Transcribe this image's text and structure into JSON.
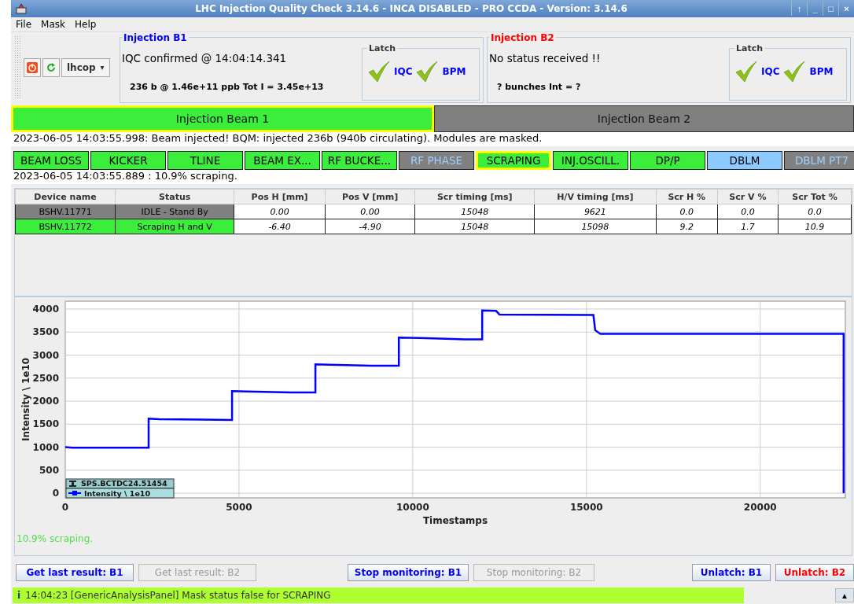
{
  "window": {
    "title": "LHC Injection Quality Check 3.14.6 -  INCA DISABLED - PRO CCDA - Version: 3.14.6",
    "controls": [
      "↑",
      "_",
      "□",
      "×"
    ]
  },
  "menu": [
    "File",
    "Mask",
    "Help"
  ],
  "toolbar": {
    "user": "lhcop",
    "caret": "▾"
  },
  "injections": [
    {
      "title": "Injection B1",
      "kind": "b1",
      "status": "IQC confirmed @ 14:04:14.341",
      "detail": "236 b @ 1.46e+11 ppb   Tot I = 3.45e+13",
      "latch": {
        "title": "Latch",
        "items": [
          {
            "label": "IQC",
            "checked": true
          },
          {
            "label": "BPM",
            "checked": true
          }
        ]
      }
    },
    {
      "title": "Injection B2",
      "kind": "b2",
      "status": "No status received !!",
      "detail": "? bunches  Int = ?",
      "latch": {
        "title": "Latch",
        "items": [
          {
            "label": "IQC",
            "checked": true
          },
          {
            "label": "BPM",
            "checked": true
          }
        ]
      }
    }
  ],
  "beam_tabs": [
    {
      "label": "Injection Beam 1",
      "selected": true
    },
    {
      "label": "Injection Beam 2",
      "selected": false
    }
  ],
  "beam_message": "2023-06-05 14:03:55.998: Beam injected! BQM: injected 236b (940b circulating). Modules are masked.",
  "modules": [
    {
      "label": "BEAM LOSS",
      "kind": "ok",
      "selected": false
    },
    {
      "label": "KICKER",
      "kind": "ok",
      "selected": false
    },
    {
      "label": "TLINE",
      "kind": "ok",
      "selected": false
    },
    {
      "label": "BEAM EX...",
      "kind": "ok",
      "selected": false
    },
    {
      "label": "RF BUCKE...",
      "kind": "ok",
      "selected": false
    },
    {
      "label": "RF PHASE",
      "kind": "masked",
      "selected": false
    },
    {
      "label": "SCRAPING",
      "kind": "ok",
      "selected": true
    },
    {
      "label": "INJ.OSCILL.",
      "kind": "ok",
      "selected": false
    },
    {
      "label": "DP/P",
      "kind": "ok",
      "selected": false
    },
    {
      "label": "DBLM",
      "kind": "info",
      "selected": false
    },
    {
      "label": "DBLM PT7",
      "kind": "masked",
      "selected": false
    }
  ],
  "module_message": "2023-06-05 14:03:55.889 : 10.9% scraping.",
  "table": {
    "columns": [
      "Device name",
      "Status",
      "Pos H [mm]",
      "Pos V [mm]",
      "Scr timing [ms]",
      "H/V timing [ms]",
      "Scr H %",
      "Scr V %",
      "Scr Tot %"
    ],
    "rows": [
      {
        "color": "#808080",
        "cells": [
          "BSHV.11771",
          "IDLE - Stand By",
          "0.00",
          "0.00",
          "15048",
          "9621",
          "0.0",
          "0.0",
          "0.0"
        ]
      },
      {
        "color": "#3cee3c",
        "cells": [
          "BSHV.11772",
          "Scraping H and V",
          "-6.40",
          "-4.90",
          "15048",
          "15098",
          "9.2",
          "1.7",
          "10.9"
        ]
      }
    ]
  },
  "chart": {
    "legend_title": "SPS.BCTDC24.51454",
    "chart_data": {
      "type": "line",
      "grid": true,
      "xlabel": "Timestamps",
      "ylabel": "Intensity \\ 1e10",
      "xlim": [
        0,
        22450
      ],
      "ylim": [
        -100,
        4170
      ],
      "xticks": [
        0,
        5000,
        10000,
        15000,
        20000
      ],
      "yticks": [
        0,
        500,
        1000,
        1500,
        2000,
        2500,
        3000,
        3500,
        4000
      ],
      "x": [
        0,
        200,
        2400,
        2400,
        2700,
        4800,
        4800,
        5200,
        6500,
        7200,
        7200,
        7600,
        8800,
        9600,
        9600,
        10200,
        11500,
        12000,
        12000,
        12400,
        12500,
        15200,
        15250,
        15400,
        22400,
        22400
      ],
      "series": [
        {
          "name": "Intensity \\ 1e10",
          "color": "#0000ff",
          "values": [
            1000,
            990,
            990,
            1620,
            1610,
            1590,
            2220,
            2210,
            2190,
            2190,
            2800,
            2790,
            2770,
            2770,
            3380,
            3370,
            3340,
            3340,
            3970,
            3960,
            3880,
            3870,
            3540,
            3460,
            3460,
            0
          ]
        }
      ]
    }
  },
  "chart_message": "10.9% scraping.",
  "buttons": [
    {
      "label": "Get last result: B1",
      "kind": "b1",
      "disabled": false
    },
    {
      "label": "Get last result: B2",
      "disabled": true
    },
    {
      "label": "Stop monitoring: B1",
      "kind": "b1",
      "disabled": false
    },
    {
      "label": "Stop monitoring: B2",
      "disabled": true
    },
    {
      "label": "Unlatch: B1",
      "kind": "b1",
      "disabled": false
    },
    {
      "label": "Unlatch: B2",
      "kind": "b2",
      "disabled": false
    }
  ],
  "status_bar": {
    "icon": "i",
    "text": "14:04:23 [GenericAnalysisPanel] Mask status false for SCRAPING",
    "scroll": "▲"
  }
}
